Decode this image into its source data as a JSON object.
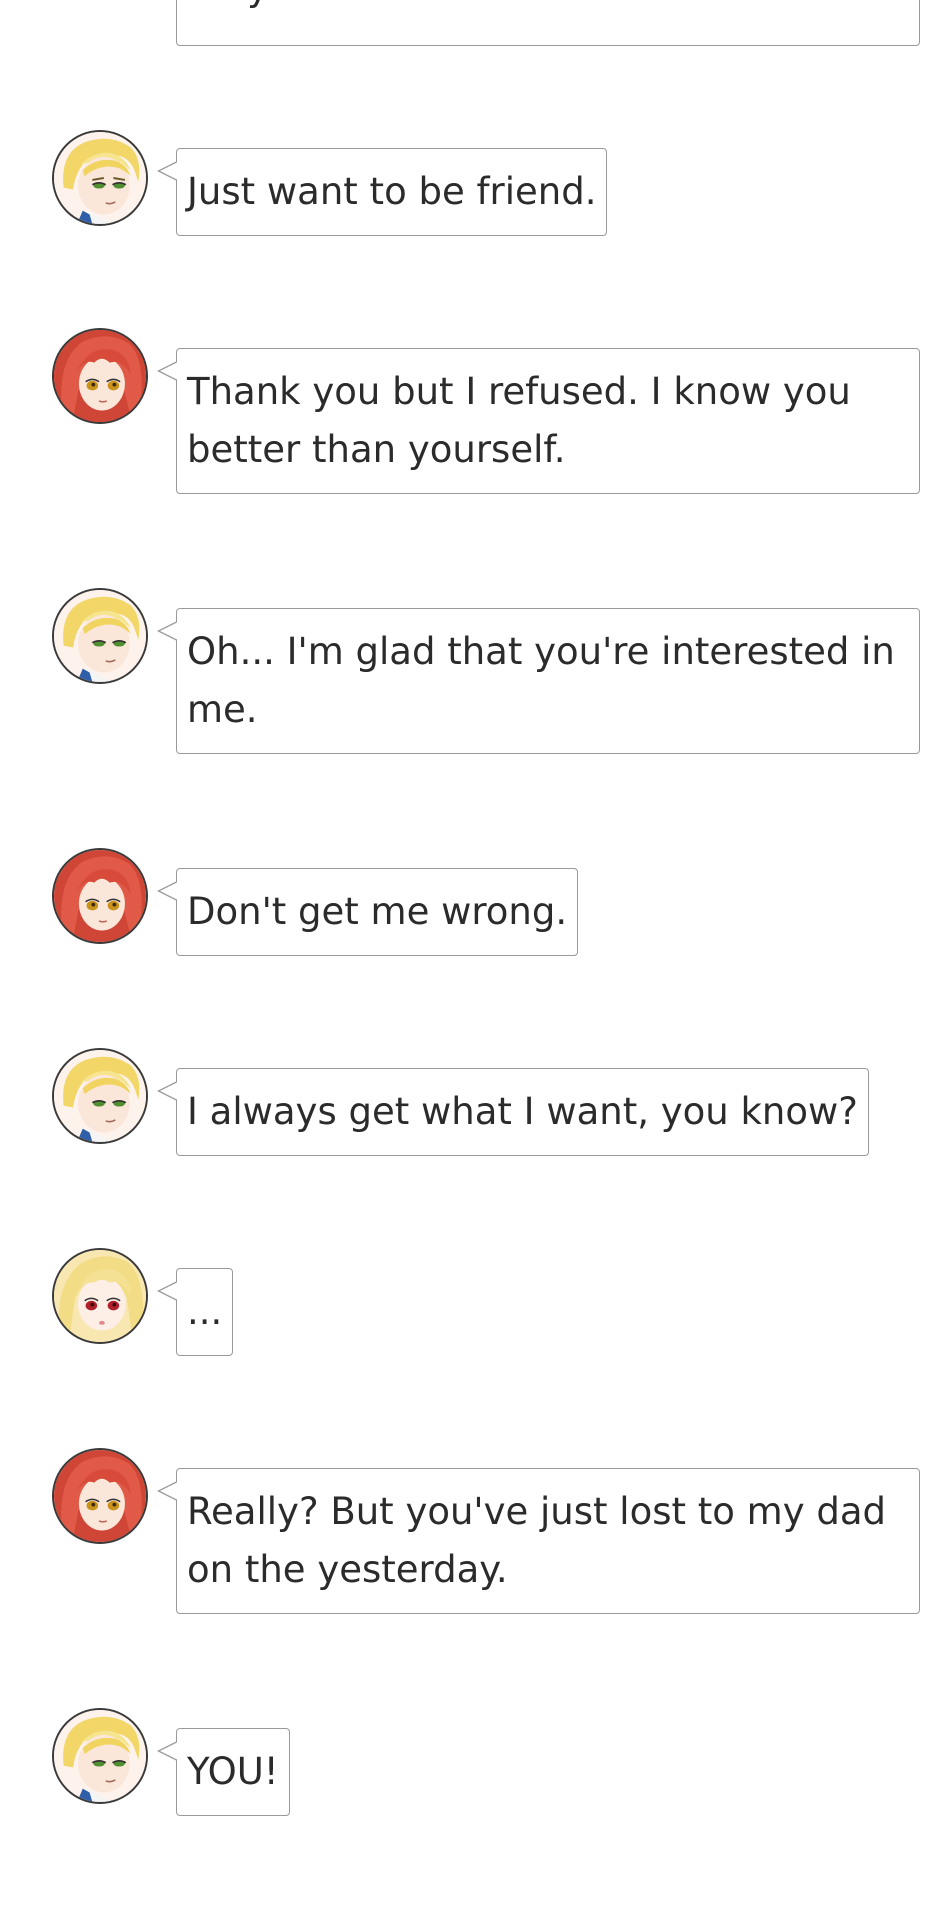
{
  "messages": [
    {
      "speaker": "boy",
      "text": "Just want to be friend."
    },
    {
      "speaker": "red-hair-girl",
      "text": "Thank you but I refused. I know you better than yourself."
    },
    {
      "speaker": "boy",
      "text": "Oh... I'm glad that you're interested in me."
    },
    {
      "speaker": "red-hair-girl",
      "text": "Don't get me wrong."
    },
    {
      "speaker": "boy",
      "text": "I always get what I want, you know?"
    },
    {
      "speaker": "blonde-girl",
      "text": "..."
    },
    {
      "speaker": "red-hair-girl",
      "text": "Really? But you've just lost to my dad on the yesterday."
    },
    {
      "speaker": "boy",
      "text": "YOU!"
    }
  ],
  "partial_message": {
    "text": "Why?"
  },
  "colors": {
    "bubble_border": "#9a9a9a",
    "text": "#2b2b2b",
    "background": "#ffffff",
    "avatar_border": "#3a3a3a"
  },
  "avatars": {
    "boy": "blonde-boy-avatar-icon",
    "red-hair-girl": "red-hair-girl-avatar-icon",
    "blonde-girl": "blonde-girl-avatar-icon"
  }
}
